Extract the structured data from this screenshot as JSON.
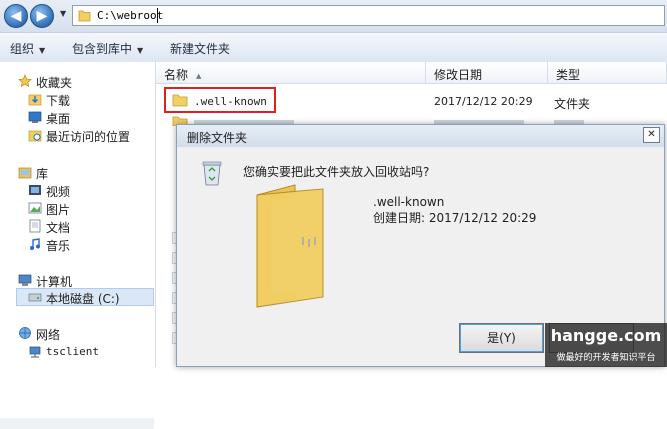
{
  "address_bar": {
    "path": "C:\\webroot",
    "back_label": "◀",
    "forward_label": "▶",
    "dropdown_label": "▼"
  },
  "toolbar": {
    "organize": "组织",
    "include_in_library": "包含到库中",
    "new_folder": "新建文件夹"
  },
  "sidebar": {
    "items": [
      {
        "label": "收藏夹",
        "icon": "star-icon"
      },
      {
        "label": "下载",
        "icon": "download-folder-icon"
      },
      {
        "label": "桌面",
        "icon": "desktop-icon"
      },
      {
        "label": "最近访问的位置",
        "icon": "recent-places-icon"
      },
      {
        "label": "库",
        "icon": "library-icon"
      },
      {
        "label": "视频",
        "icon": "video-icon"
      },
      {
        "label": "图片",
        "icon": "picture-icon"
      },
      {
        "label": "文档",
        "icon": "document-icon"
      },
      {
        "label": "音乐",
        "icon": "music-icon"
      },
      {
        "label": "计算机",
        "icon": "computer-icon"
      },
      {
        "label": "本地磁盘 (C:)",
        "icon": "disk-icon"
      },
      {
        "label": "网络",
        "icon": "network-icon"
      },
      {
        "label": "tsclient",
        "icon": "network-share-icon"
      }
    ]
  },
  "file_list": {
    "columns": [
      "名称",
      "修改日期",
      "类型"
    ],
    "rows": [
      {
        "name": ".well-known",
        "date": "2017/12/12 20:29",
        "type": "文件夹"
      }
    ]
  },
  "dialog": {
    "title": "删除文件夹",
    "question": "您确实要把此文件夹放入回收站吗?",
    "file_name": ".well-known",
    "created": "创建日期: 2017/12/12 20:29",
    "yes_label": "是(Y)",
    "close_label": "✕"
  },
  "watermark": {
    "site": "hangge.com",
    "slogan": "做最好的开发者知识平台"
  },
  "colors": {
    "highlight": "#e02020",
    "selection": "#d9e7f6",
    "folder": "#f2cf63"
  }
}
